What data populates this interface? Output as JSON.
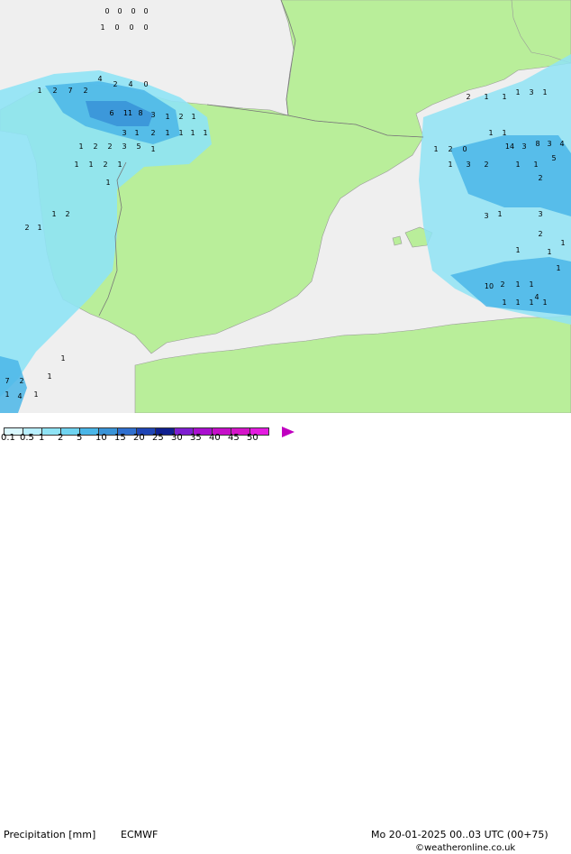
{
  "title": "Precipitation [mm]",
  "model": "ECMWF",
  "valid_time": "Mo 20-01-2025 00..03 UTC (00+75)",
  "credit": "©weatheronline.co.uk",
  "colors": {
    "sea": "#efefef",
    "land": "#b9ee9a",
    "border": "#777777"
  },
  "scale": {
    "ticks": [
      "0.1",
      "0.5",
      "1",
      "2",
      "5",
      "10",
      "15",
      "20",
      "25",
      "30",
      "35",
      "40",
      "45",
      "50"
    ],
    "swatches": [
      "#d9f7ff",
      "#b8efff",
      "#8fe3f5",
      "#6fd3f0",
      "#4ab6e8",
      "#3a94d8",
      "#2f6fcf",
      "#1f45b5",
      "#0f1f8f",
      "#7f1fd1",
      "#a90fcf",
      "#c60fc9",
      "#d515c9",
      "#e41be0"
    ],
    "arrow_color": "#c000c0"
  },
  "map_values": [
    {
      "v": "0"
    },
    {
      "v": "0"
    },
    {
      "v": "0"
    },
    {
      "v": "0"
    },
    {
      "v": "1"
    },
    {
      "v": "0"
    },
    {
      "v": "0"
    },
    {
      "v": "0"
    },
    {
      "v": "1"
    },
    {
      "v": "2"
    },
    {
      "v": "7"
    },
    {
      "v": "2"
    },
    {
      "v": "4"
    },
    {
      "v": "2"
    },
    {
      "v": "4"
    },
    {
      "v": "0"
    },
    {
      "v": "6"
    },
    {
      "v": "11"
    },
    {
      "v": "8"
    },
    {
      "v": "3"
    },
    {
      "v": "1"
    },
    {
      "v": "2"
    },
    {
      "v": "1"
    },
    {
      "v": "3"
    },
    {
      "v": "1"
    },
    {
      "v": "2"
    },
    {
      "v": "1"
    },
    {
      "v": "1"
    },
    {
      "v": "1"
    },
    {
      "v": "1"
    },
    {
      "v": "1"
    },
    {
      "v": "2"
    },
    {
      "v": "2"
    },
    {
      "v": "3"
    },
    {
      "v": "5"
    },
    {
      "v": "1"
    },
    {
      "v": "1"
    },
    {
      "v": "1"
    },
    {
      "v": "2"
    },
    {
      "v": "1"
    },
    {
      "v": "1"
    },
    {
      "v": "2"
    },
    {
      "v": "1"
    },
    {
      "v": "1"
    },
    {
      "v": "1"
    },
    {
      "v": "3"
    },
    {
      "v": "1"
    },
    {
      "v": "1"
    },
    {
      "v": "2"
    },
    {
      "v": "0"
    },
    {
      "v": "14"
    },
    {
      "v": "3"
    },
    {
      "v": "8"
    },
    {
      "v": "3"
    },
    {
      "v": "4"
    },
    {
      "v": "1"
    },
    {
      "v": "1"
    },
    {
      "v": "1"
    },
    {
      "v": "3"
    },
    {
      "v": "2"
    },
    {
      "v": "1"
    },
    {
      "v": "1"
    },
    {
      "v": "5"
    },
    {
      "v": "2"
    },
    {
      "v": "10"
    },
    {
      "v": "2"
    },
    {
      "v": "1"
    },
    {
      "v": "1"
    },
    {
      "v": "4"
    },
    {
      "v": "1"
    },
    {
      "v": "1"
    },
    {
      "v": "1"
    },
    {
      "v": "1"
    },
    {
      "v": "3"
    },
    {
      "v": "1"
    },
    {
      "v": "3"
    },
    {
      "v": "2"
    },
    {
      "v": "1"
    },
    {
      "v": "1"
    },
    {
      "v": "1"
    },
    {
      "v": "1"
    },
    {
      "v": "2"
    },
    {
      "v": "1"
    },
    {
      "v": "1"
    },
    {
      "v": "2"
    },
    {
      "v": "7"
    },
    {
      "v": "2"
    },
    {
      "v": "4"
    },
    {
      "v": "1"
    },
    {
      "v": "1"
    },
    {
      "v": "1"
    },
    {
      "v": "1"
    }
  ]
}
